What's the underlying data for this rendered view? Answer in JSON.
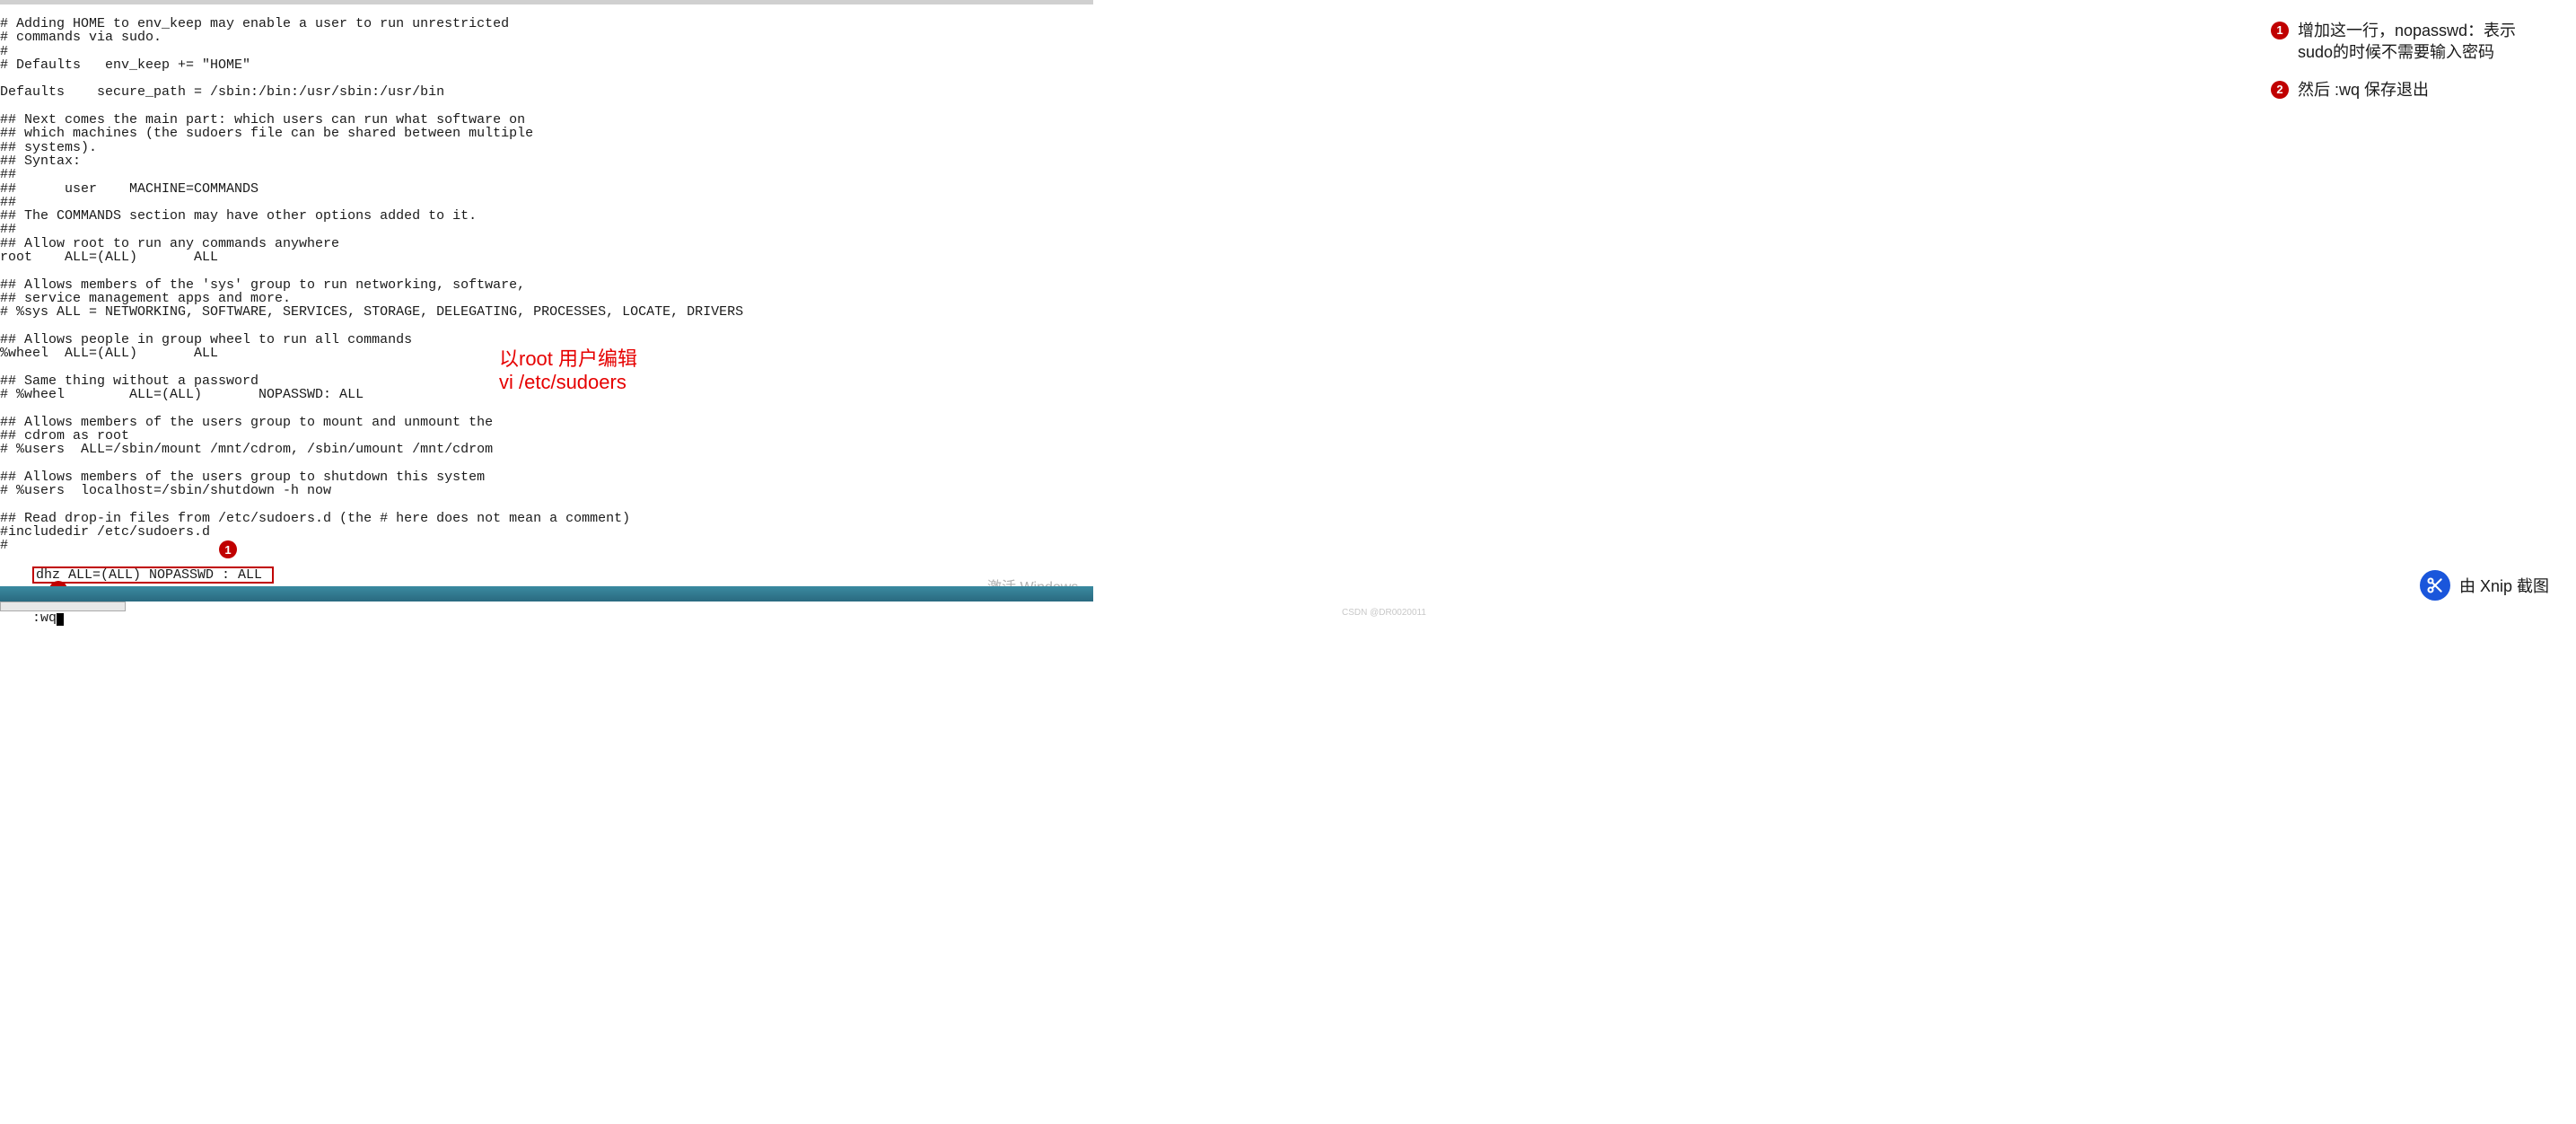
{
  "terminal": {
    "lines": [
      "# Adding HOME to env_keep may enable a user to run unrestricted",
      "# commands via sudo.",
      "#",
      "# Defaults   env_keep += \"HOME\"",
      "",
      "Defaults    secure_path = /sbin:/bin:/usr/sbin:/usr/bin",
      "",
      "## Next comes the main part: which users can run what software on",
      "## which machines (the sudoers file can be shared between multiple",
      "## systems).",
      "## Syntax:",
      "##",
      "##      user    MACHINE=COMMANDS",
      "##",
      "## The COMMANDS section may have other options added to it.",
      "##",
      "## Allow root to run any commands anywhere",
      "root    ALL=(ALL)       ALL",
      "",
      "## Allows members of the 'sys' group to run networking, software,",
      "## service management apps and more.",
      "# %sys ALL = NETWORKING, SOFTWARE, SERVICES, STORAGE, DELEGATING, PROCESSES, LOCATE, DRIVERS",
      "",
      "## Allows people in group wheel to run all commands",
      "%wheel  ALL=(ALL)       ALL",
      "",
      "## Same thing without a password",
      "# %wheel        ALL=(ALL)       NOPASSWD: ALL",
      "",
      "## Allows members of the users group to mount and unmount the",
      "## cdrom as root",
      "# %users  ALL=/sbin/mount /mnt/cdrom, /sbin/umount /mnt/cdrom",
      "",
      "## Allows members of the users group to shutdown this system",
      "# %users  localhost=/sbin/shutdown -h now",
      "",
      "## Read drop-in files from /etc/sudoers.d (the # here does not mean a comment)",
      "#includedir /etc/sudoers.d"
    ],
    "hash_line": "#",
    "highlighted_line": "dhz ALL=(ALL) NOPASSWD : ALL ",
    "wq_command": ":wq"
  },
  "center_annotation": {
    "line1": "以root 用户编辑",
    "line2": "vi  /etc/sudoers"
  },
  "right_notes": {
    "item1": "增加这一行，nopasswd：表示sudo的时候不需要输入密码",
    "item2": "然后 :wq 保存退出"
  },
  "badges": {
    "b1": "1",
    "b2": "2"
  },
  "activate_windows": "激活 Windows",
  "xnip_label": "由 Xnip 截图",
  "csdn_mark": "CSDN @DR0020011"
}
